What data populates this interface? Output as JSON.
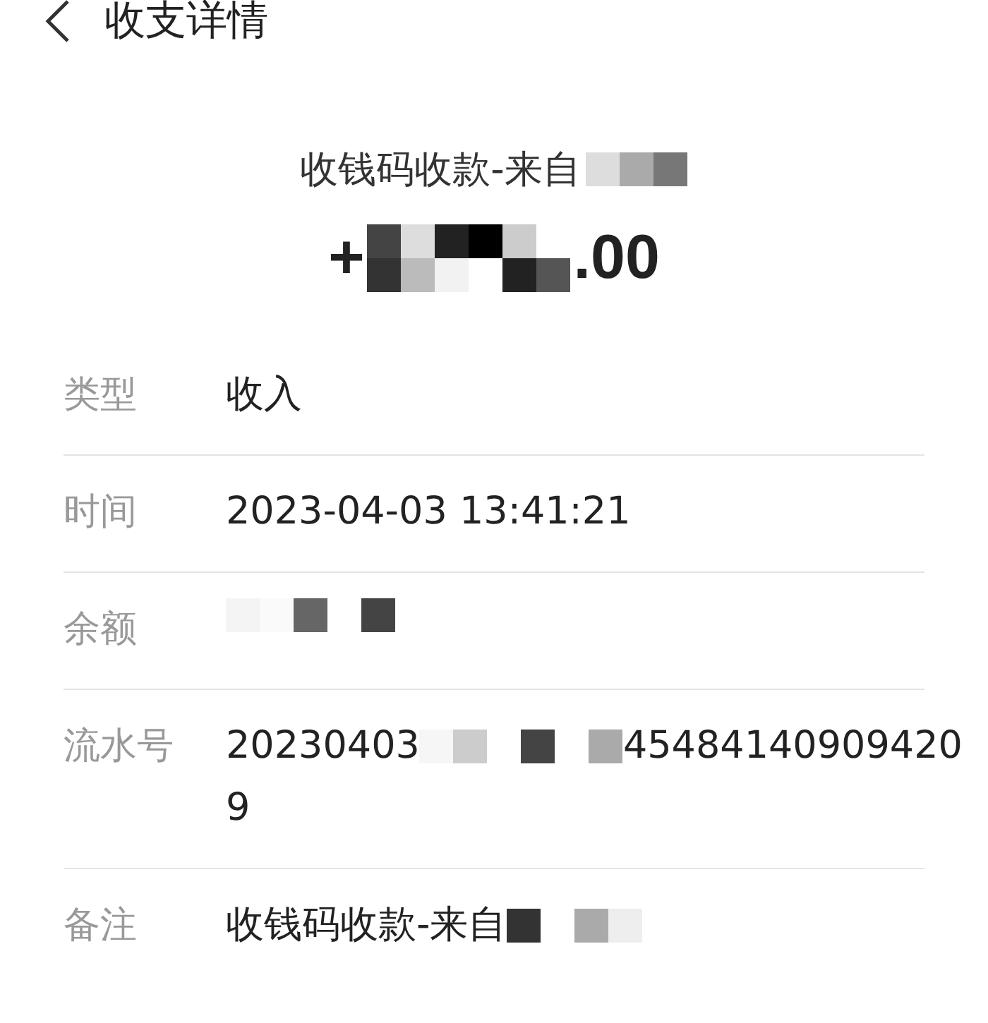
{
  "header": {
    "title": "收支详情"
  },
  "summary": {
    "title": "收钱码收款-来自",
    "amount_prefix": "+",
    "amount_suffix": ".00"
  },
  "details": [
    {
      "kind": "text",
      "label": "类型",
      "value": "收入"
    },
    {
      "kind": "text",
      "label": "时间",
      "value": "2023-04-03 13:41:21"
    },
    {
      "kind": "redacted",
      "label": "余额"
    },
    {
      "kind": "serial",
      "label": "流水号",
      "value_start": "20230403",
      "value_end": "45484140909420",
      "value_wrap": "9"
    },
    {
      "kind": "text_redacted",
      "label": "备注",
      "value": "收钱码收款-来自"
    }
  ]
}
